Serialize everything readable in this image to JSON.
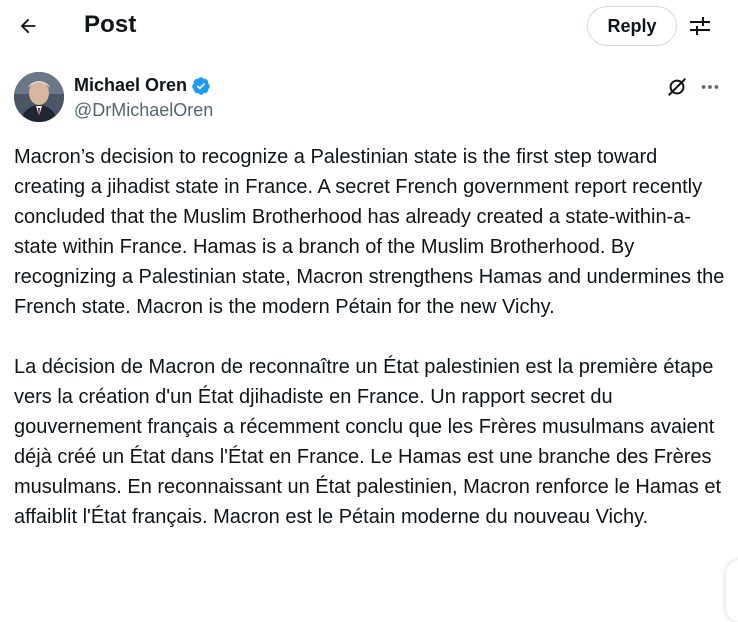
{
  "header": {
    "title": "Post",
    "reply_label": "Reply"
  },
  "author": {
    "name": "Michael Oren",
    "handle": "@DrMichaelOren",
    "verified": true
  },
  "post": {
    "paragraph_en": "Macron’s decision to recognize a Palestinian state is the first step toward creating a jihadist state in France. A secret French government report recently concluded that the Muslim Brotherhood has already created a state-within-a-state within France. Hamas is a branch of the Muslim Brotherhood. By recognizing a Palestinian state, Macron strengthens Hamas and undermines the French state. Macron is the modern Pétain for the new Vichy.",
    "paragraph_fr": "La décision de Macron de reconnaître un État palestinien est la première étape vers la création d'un État djihadiste en France. Un rapport secret du gouvernement français a récemment conclu que les Frères musulmans avaient déjà créé un État dans l'État en France. Le Hamas est une branche des Frères musulmans. En reconnaissant un État palestinien, Macron renforce le Hamas et affaiblit l'État français. Macron est le Pétain moderne du nouveau Vichy."
  },
  "icons": {
    "back": "arrow-left-icon",
    "filter": "sliders-icon",
    "verified": "verified-badge-icon",
    "grok": "grok-icon",
    "more": "more-horizontal-icon"
  },
  "colors": {
    "text": "#0f1419",
    "secondary": "#536471",
    "verified": "#1d9bf0",
    "border": "#cfd9de"
  }
}
